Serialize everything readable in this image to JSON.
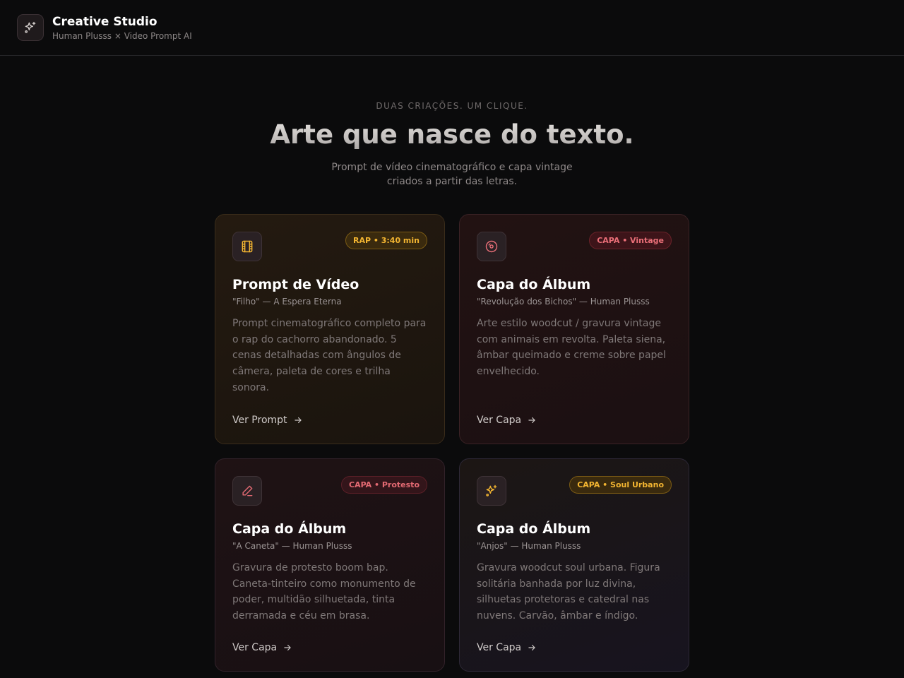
{
  "header": {
    "title": "Creative Studio",
    "subtitle": "Human Plusss × Video Prompt AI"
  },
  "hero": {
    "kicker": "DUAS CRIAÇÕES. UM CLIQUE.",
    "headline": "Arte que nasce do texto.",
    "subtitle": "Prompt de vídeo cinematográfico e capa vintage criados a partir das letras."
  },
  "cards": [
    {
      "badge": "RAP • 3:40 min",
      "title": "Prompt de Vídeo",
      "meta": "\"Filho\" — A Espera Eterna",
      "description": "Prompt cinematográfico completo para o rap do cachorro abandonado. 5 cenas detalhadas com ângulos de câmera, paleta de cores e trilha sonora.",
      "link": "Ver Prompt",
      "icon": "film-icon",
      "accent": "#f3b531"
    },
    {
      "badge": "CAPA • Vintage",
      "title": "Capa do Álbum",
      "meta": "\"Revolução dos Bichos\" — Human Plusss",
      "description": "Arte estilo woodcut / gravura vintage com animais em revolta. Paleta siena, âmbar queimado e creme sobre papel envelhecido.",
      "link": "Ver Capa",
      "icon": "disc-icon",
      "accent": "#ea6f78"
    },
    {
      "badge": "CAPA • Protesto",
      "title": "Capa do Álbum",
      "meta": "\"A Caneta\" — Human Plusss",
      "description": "Gravura de protesto boom bap. Caneta-tinteiro como monumento de poder, multidão silhuetada, tinta derramada e céu em brasa.",
      "link": "Ver Capa",
      "icon": "pen-icon",
      "accent": "#e46a73"
    },
    {
      "badge": "CAPA • Soul Urbano",
      "title": "Capa do Álbum",
      "meta": "\"Anjos\" — Human Plusss",
      "description": "Gravura woodcut soul urbana. Figura solitária banhada por luz divina, silhuetas protetoras e catedral nas nuvens. Carvão, âmbar e índigo.",
      "link": "Ver Capa",
      "icon": "sparkles-icon",
      "accent": "#f3b531"
    }
  ]
}
